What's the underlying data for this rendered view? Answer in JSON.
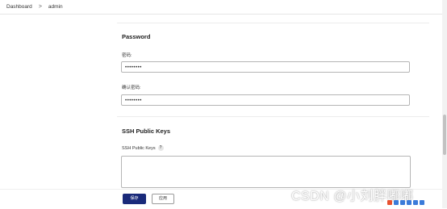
{
  "breadcrumb": {
    "items": [
      "Dashboard",
      "admin"
    ],
    "separator": ">"
  },
  "password": {
    "title": "Password",
    "field1_label": "密码:",
    "field1_value": "••••••••",
    "field2_label": "确认密码:",
    "field2_value": "••••••••"
  },
  "ssh": {
    "title": "SSH Public Keys",
    "field_label": "SSH Public Keys",
    "help": "?"
  },
  "buttons": {
    "save": "保存",
    "apply": "应用"
  },
  "watermark": "CSDN @小刘胖嘟嘟",
  "colors": {
    "primary": "#1a2a7a",
    "border": "#b5b5b5"
  }
}
